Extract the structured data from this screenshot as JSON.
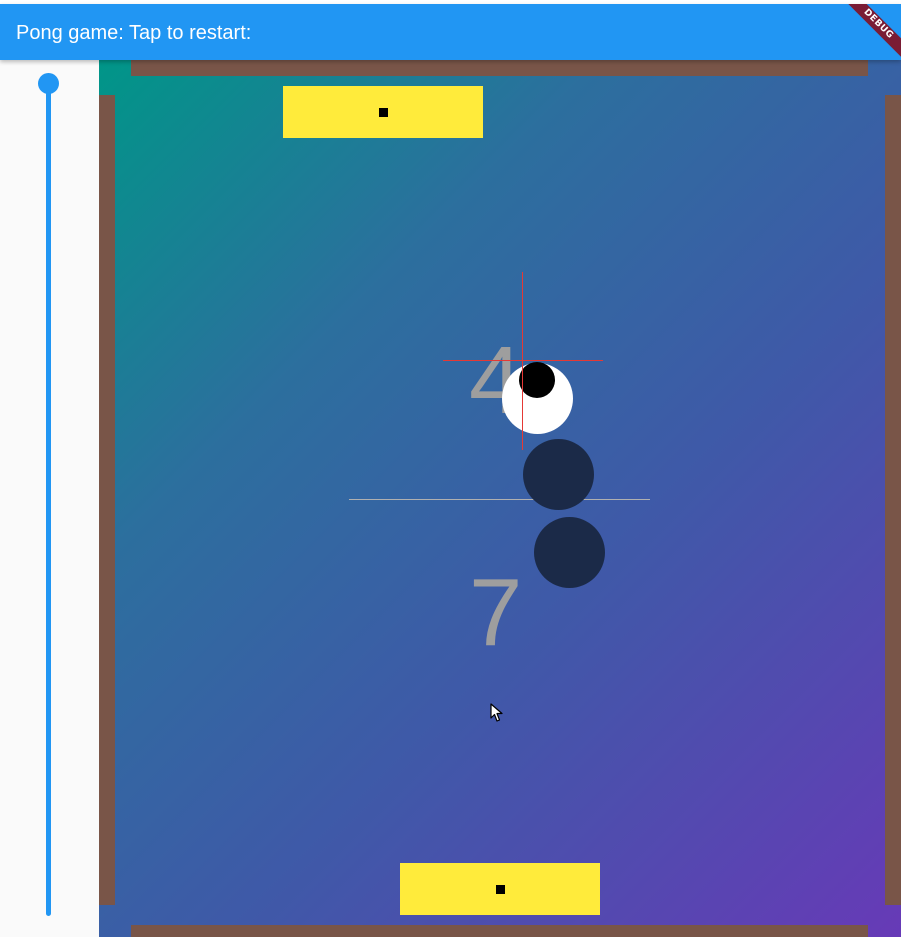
{
  "app": {
    "title": "Pong game: Tap to restart:",
    "debug_banner": "DEBUG"
  },
  "speed_slider": {
    "value_fraction": 1.0,
    "orientation": "vertical"
  },
  "game": {
    "score_top": "4",
    "score_bottom": "7",
    "paddle_top_marker": "square",
    "paddle_bottom_marker": "square"
  },
  "colors": {
    "app_bar": "#2196f3",
    "wall": "#795548",
    "paddle": "#ffeb3b",
    "background_gradient_start": "#009688",
    "background_gradient_end": "#673ab7",
    "ball": "#ffffff",
    "ball_shadow": "#1b2a48",
    "crosshair": "#e53935",
    "score": "#9e9e9e",
    "debug_banner": "#7a1c35"
  },
  "icons": {
    "cursor": "mouse-pointer-icon"
  }
}
